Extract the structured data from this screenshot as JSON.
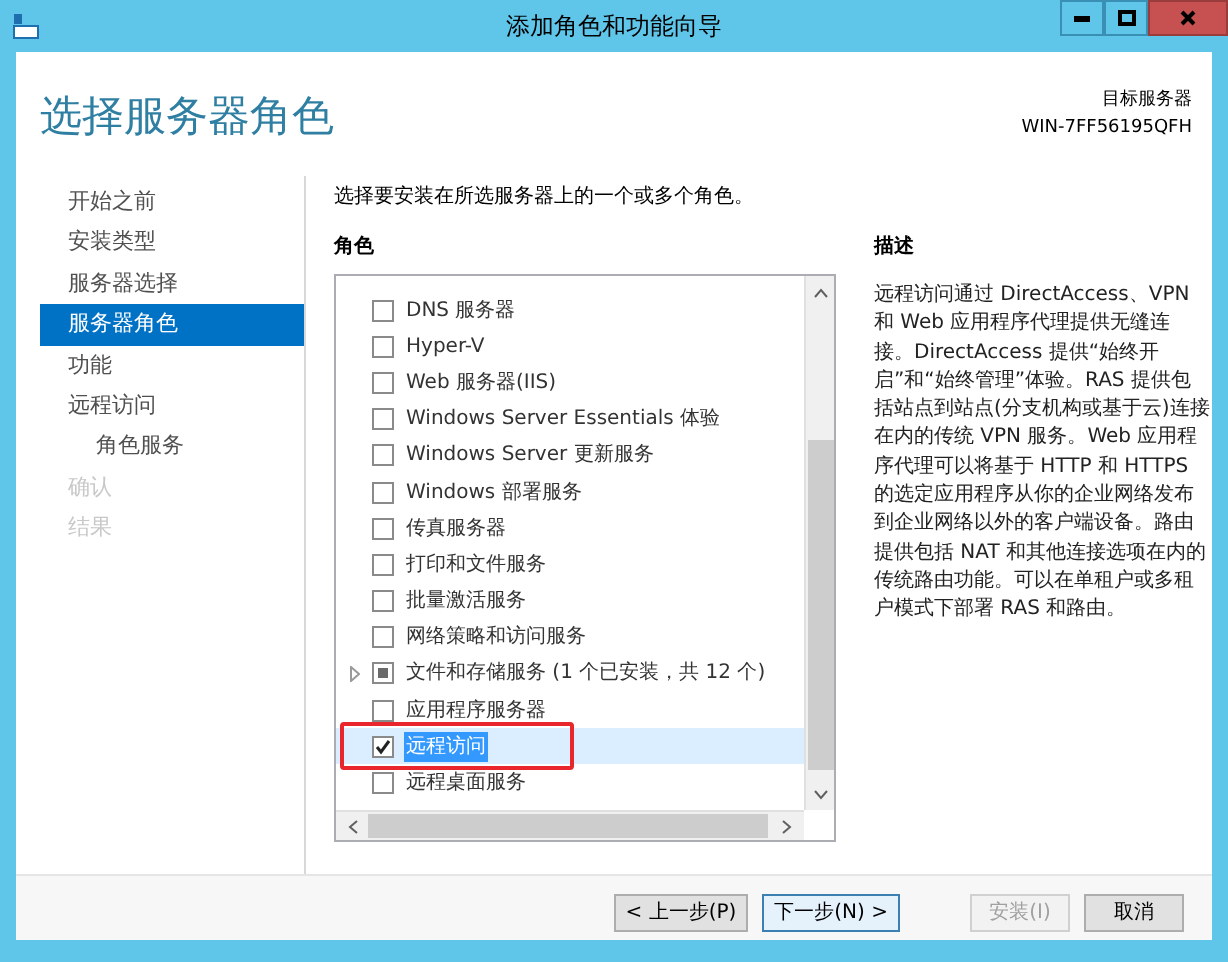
{
  "window": {
    "title": "添加角色和功能向导"
  },
  "page_title": "选择服务器角色",
  "target_server": {
    "label": "目标服务器",
    "name": "WIN-7FF56195QFH"
  },
  "steps": [
    {
      "label": "开始之前",
      "selected": false,
      "disabled": false
    },
    {
      "label": "安装类型",
      "selected": false,
      "disabled": false
    },
    {
      "label": "服务器选择",
      "selected": false,
      "disabled": false
    },
    {
      "label": "服务器角色",
      "selected": true,
      "disabled": false
    },
    {
      "label": "功能",
      "selected": false,
      "disabled": false
    },
    {
      "label": "远程访问",
      "selected": false,
      "disabled": false,
      "children": [
        {
          "label": "角色服务",
          "selected": false,
          "disabled": false
        }
      ]
    },
    {
      "label": "确认",
      "selected": false,
      "disabled": true
    },
    {
      "label": "结果",
      "selected": false,
      "disabled": true
    }
  ],
  "instruction": "选择要安装在所选服务器上的一个或多个角色。",
  "roles_heading": "角色",
  "roles": [
    {
      "kind": "role",
      "label": "DNS 服务器",
      "checked": false,
      "selected": false,
      "outlined": false
    },
    {
      "kind": "role",
      "label": "Hyper-V",
      "checked": false,
      "selected": false,
      "outlined": false
    },
    {
      "kind": "role",
      "label": "Web 服务器(IIS)",
      "checked": false,
      "selected": false,
      "outlined": false
    },
    {
      "kind": "role",
      "label": "Windows Server Essentials 体验",
      "checked": false,
      "selected": false,
      "outlined": false
    },
    {
      "kind": "role",
      "label": "Windows Server 更新服务",
      "checked": false,
      "selected": false,
      "outlined": false
    },
    {
      "kind": "role",
      "label": "Windows 部署服务",
      "checked": false,
      "selected": false,
      "outlined": false
    },
    {
      "kind": "role",
      "label": "传真服务器",
      "checked": false,
      "selected": false,
      "outlined": false
    },
    {
      "kind": "role",
      "label": "打印和文件服务",
      "checked": false,
      "selected": false,
      "outlined": false
    },
    {
      "kind": "role",
      "label": "批量激活服务",
      "checked": false,
      "selected": false,
      "outlined": false
    },
    {
      "kind": "role",
      "label": "网络策略和访问服务",
      "checked": false,
      "selected": false,
      "outlined": false
    },
    {
      "kind": "group",
      "label": "文件和存储服务 (1 个已安装，共 12 个)",
      "partial": true,
      "selected": false,
      "outlined": false
    },
    {
      "kind": "role",
      "label": "应用程序服务器",
      "checked": false,
      "selected": false,
      "outlined": false
    },
    {
      "kind": "role",
      "label": "远程访问",
      "checked": true,
      "selected": true,
      "outlined": true
    },
    {
      "kind": "role",
      "label": "远程桌面服务",
      "checked": false,
      "selected": false,
      "outlined": false
    }
  ],
  "description": {
    "heading": "描述",
    "text": "远程访问通过 DirectAccess、VPN 和 Web 应用程序代理提供无缝连接。DirectAccess 提供“始终开启”和“始终管理”体验。RAS 提供包括站点到站点(分支机构或基于云)连接在内的传统 VPN 服务。Web 应用程序代理可以将基于 HTTP 和 HTTPS 的选定应用程序从你的企业网络发布到企业网络以外的客户端设备。路由提供包括 NAT 和其他连接选项在内的传统路由功能。可以在单租户或多租户模式下部署 RAS 和路由。"
  },
  "buttons": [
    {
      "label": "< 上一步(P)",
      "disabled": false,
      "selected": false
    },
    {
      "label": "下一步(N) >",
      "disabled": false,
      "selected": true
    },
    {
      "label": "安装(I)",
      "disabled": true,
      "selected": false
    },
    {
      "label": "取消",
      "disabled": false,
      "selected": false
    }
  ]
}
